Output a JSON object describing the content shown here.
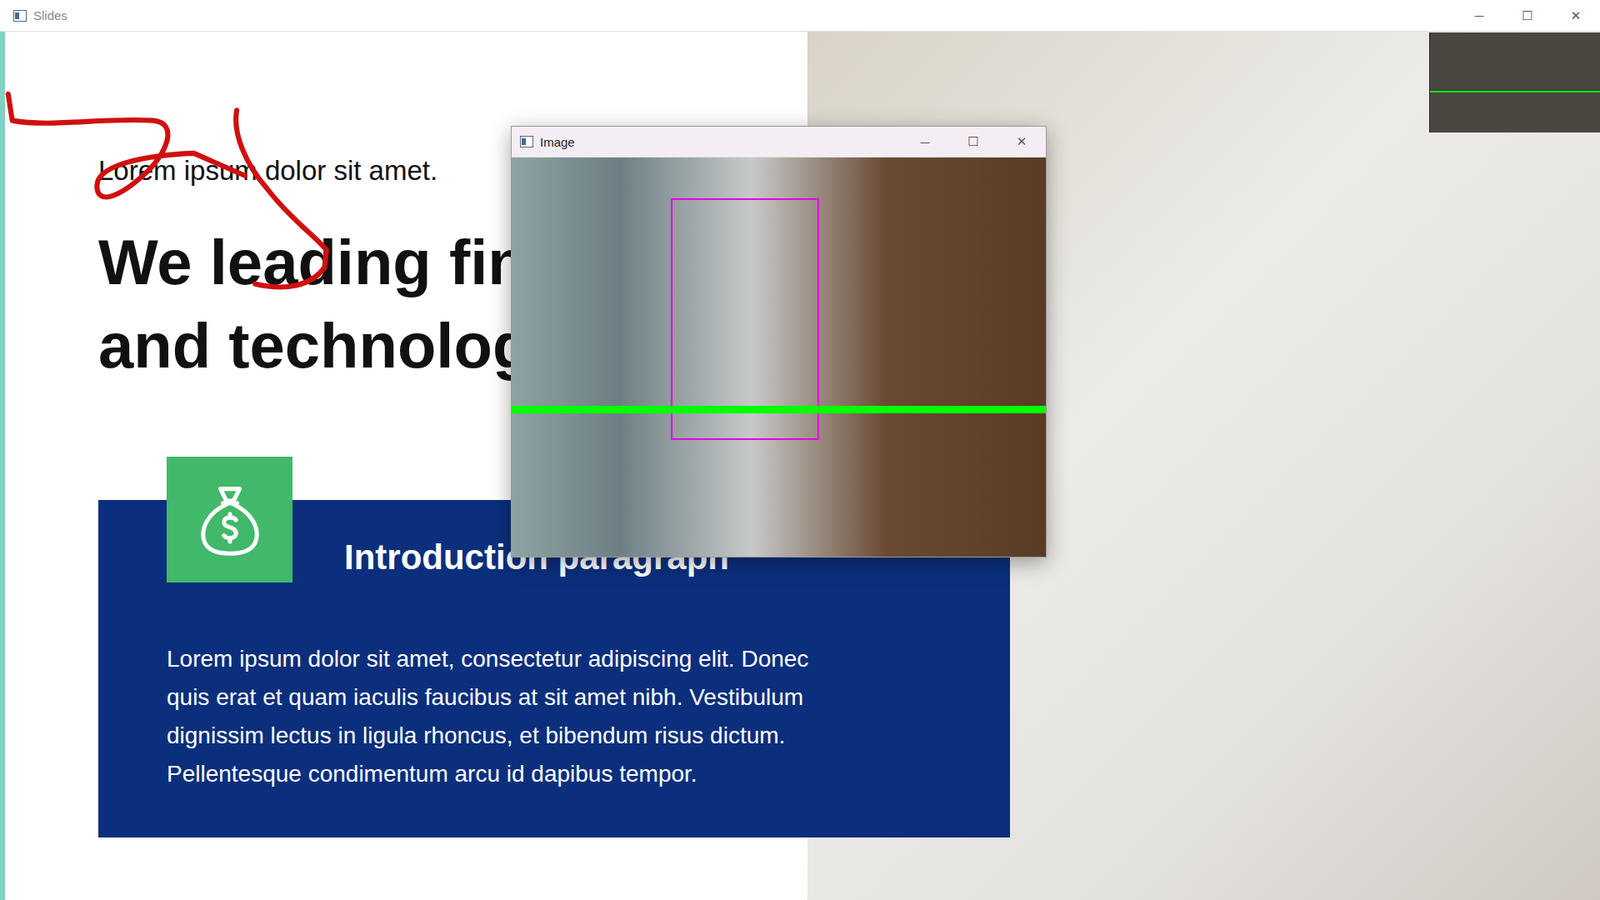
{
  "window": {
    "title": "Slides",
    "controls": [
      "─",
      "☐",
      "✕"
    ]
  },
  "slide": {
    "subtitle": "Lorem ipsum dolor sit amet.",
    "heading": [
      "We leading fin",
      "and technolog"
    ],
    "card": {
      "title": "Introduction paragraph",
      "paragraph": [
        "Lorem ipsum dolor sit amet, consectetur adipiscing elit. Donec",
        "quis erat et quam iaculis faucibus at sit amet nibh. Vestibulum",
        "dignissim lectus in ligula rhoncus, et bibendum risus dictum.",
        "Pellentesque condimentum arcu id dapibus tempor."
      ]
    }
  },
  "camera_window": {
    "title": "Image",
    "controls": [
      "─",
      "☐",
      "✕"
    ]
  }
}
